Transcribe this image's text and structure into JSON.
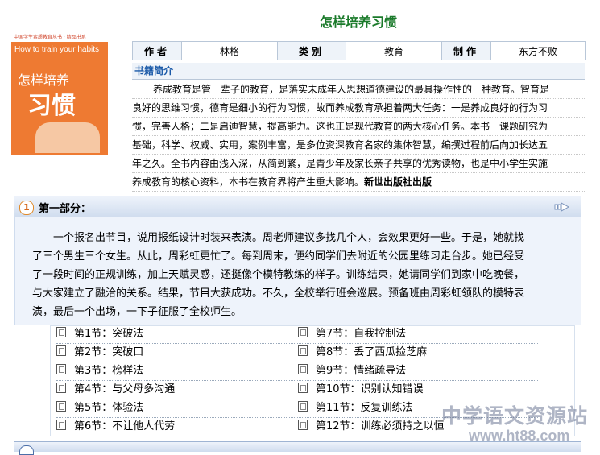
{
  "book": {
    "title": "怎样培养习惯",
    "cover": {
      "band_text": "中国学生素质教育丛书 · 精品书系",
      "en_title": "How to train your habits",
      "zh_line1": "怎样培养",
      "zh_line2": "习惯"
    },
    "meta": {
      "author_label": "作者",
      "author_value": "林格",
      "category_label": "类别",
      "category_value": "教育",
      "maker_label": "制作",
      "maker_value": "东方不败"
    },
    "intro_label": "书籍简介",
    "intro_lines": [
      "养成教育是管一辈子的教育，是落实未成年人思想道德建设的最具操作性的一种教育。智育是",
      "良好的思维习惯，德育是细小的行为习惯，故而养成教育承担着两大任务：一是养成良好的行为习",
      "惯，完善人格；二是启迪智慧，提高能力。这也正是现代教育的两大核心任务。本书一课题研究为",
      "基础，科学、权威、实用，案例丰富，是多位资深教育名家的集体智慧，编撰过程前后向加长达五",
      "年之久。全书内容由浅入深，从简到繁，是青少年及家长亲子共享的优秀读物，也是中小学生实施",
      "养成教育的核心资料，本书在教育界将产生重大影响。"
    ],
    "intro_publisher": "新世出版社出版"
  },
  "part": {
    "number": "1",
    "title": "第一部分：",
    "text_lines": [
      "一个报名出节目，说用报纸设计时装来表演。周老师建议多找几个人，会效果更好一些。于是，她就找",
      "了三个男生三个女生。从此，周彩虹更忙了。每到周末，便约同学们去附近的公园里练习走台步。她已经受",
      "了一段时间的正规训练，加上天赋灵感，还挺像个模特教练的样子。训练结束，她请同学们到家中吃晚餐，",
      "与大家建立了融洽的关系。结果，节目大获成功。不久，全校举行班会巡展。预备班由周彩虹领队的模特表",
      "演，最后一个出场，一下子征服了全校师生。"
    ]
  },
  "chapters": [
    {
      "label": "第1节：突破法"
    },
    {
      "label": "第2节：突破口"
    },
    {
      "label": "第3节：榜样法"
    },
    {
      "label": "第4节：与父母多沟通"
    },
    {
      "label": "第5节：体验法"
    },
    {
      "label": "第6节：不让他人代劳"
    },
    {
      "label": "第7节：自我控制法"
    },
    {
      "label": "第8节：丢了西瓜捡芝麻"
    },
    {
      "label": "第9节：情绪疏导法"
    },
    {
      "label": "第10节：识别认知错误"
    },
    {
      "label": "第11节：反复训练法"
    },
    {
      "label": "第12节：训练必须持之以恒"
    }
  ],
  "watermark": {
    "line1": "中学语文资源站",
    "line2": "www.ht88.com"
  },
  "colors": {
    "title_green": "#1a7a2a",
    "intro_blue": "#1b5aa8",
    "cover_orange": "#ee7a32"
  }
}
